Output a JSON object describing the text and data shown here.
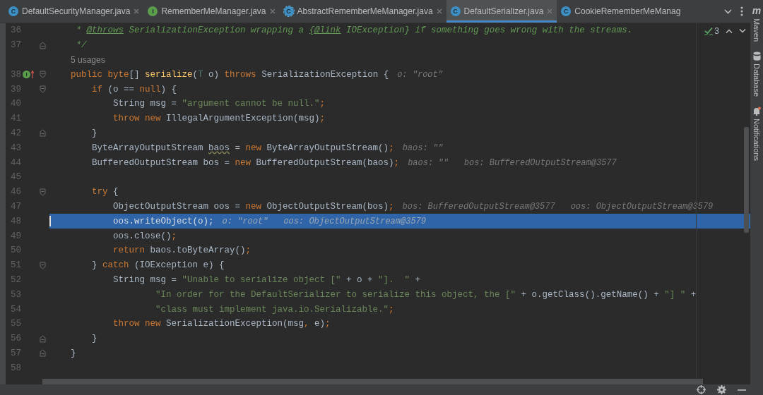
{
  "tabs": [
    {
      "label": "DefaultSecurityManager.java",
      "icon": {
        "kind": "class",
        "letter": "C"
      },
      "selected": false,
      "closable": true
    },
    {
      "label": "RememberMeManager.java",
      "icon": {
        "kind": "interface",
        "letter": "I"
      },
      "selected": false,
      "closable": true
    },
    {
      "label": "AbstractRememberMeManager.java",
      "icon": {
        "kind": "abstract",
        "letter": "C"
      },
      "selected": false,
      "closable": true
    },
    {
      "label": "DefaultSerializer.java",
      "icon": {
        "kind": "class",
        "letter": "C"
      },
      "selected": true,
      "closable": true
    },
    {
      "label": "CookieRememberMeManag",
      "icon": {
        "kind": "class",
        "letter": "C"
      },
      "selected": false,
      "closable": false
    }
  ],
  "inspections": {
    "count": "3"
  },
  "editor": {
    "lines": [
      {
        "kind": "code",
        "number": "36",
        "current": false,
        "tokens": [
          {
            "kind": "doc",
            "text": "     * "
          },
          {
            "kind": "doctag",
            "text": "@throws"
          },
          {
            "kind": "doc",
            "text": " SerializationException wrapping a "
          },
          {
            "kind": "doctag",
            "text": "{@link"
          },
          {
            "kind": "doc",
            "text": " IOException} if something goes wrong with the streams."
          }
        ]
      },
      {
        "kind": "code",
        "number": "37",
        "current": false,
        "fold": {
          "kind": "end"
        },
        "tokens": [
          {
            "kind": "doc",
            "text": "     */"
          }
        ]
      },
      {
        "kind": "usages",
        "text": "5 usages"
      },
      {
        "kind": "code",
        "number": "38",
        "current": false,
        "fold": {
          "kind": "start"
        },
        "marker": {
          "kind": "implements",
          "letter": "I"
        },
        "tokens": [
          {
            "kind": "kw",
            "text": "    public byte"
          },
          {
            "kind": "plain",
            "text": "[] "
          },
          {
            "kind": "fn",
            "text": "serialize"
          },
          {
            "kind": "plain",
            "text": "("
          },
          {
            "kind": "tparam",
            "text": "T"
          },
          {
            "kind": "plain",
            "text": " o) "
          },
          {
            "kind": "kw",
            "text": "throws"
          },
          {
            "kind": "plain",
            "text": " SerializationException {"
          }
        ],
        "hints": [
          "o: \"root\""
        ]
      },
      {
        "kind": "code",
        "number": "39",
        "current": false,
        "fold": {
          "kind": "start"
        },
        "tokens": [
          {
            "kind": "kw",
            "text": "        if"
          },
          {
            "kind": "plain",
            "text": " (o == "
          },
          {
            "kind": "kw",
            "text": "null"
          },
          {
            "kind": "plain",
            "text": ") {"
          }
        ]
      },
      {
        "kind": "code",
        "number": "40",
        "current": false,
        "tokens": [
          {
            "kind": "plain",
            "text": "            String msg = "
          },
          {
            "kind": "str",
            "text": "\"argument cannot be null.\""
          },
          {
            "kind": "punct",
            "text": ";"
          }
        ]
      },
      {
        "kind": "code",
        "number": "41",
        "current": false,
        "tokens": [
          {
            "kind": "kw",
            "text": "            throw new "
          },
          {
            "kind": "plain",
            "text": "IllegalArgumentException(msg)"
          },
          {
            "kind": "punct",
            "text": ";"
          }
        ]
      },
      {
        "kind": "code",
        "number": "42",
        "current": false,
        "fold": {
          "kind": "end"
        },
        "tokens": [
          {
            "kind": "plain",
            "text": "        }"
          }
        ]
      },
      {
        "kind": "code",
        "number": "43",
        "current": false,
        "tokens": [
          {
            "kind": "plain",
            "text": "        ByteArrayOutputStream "
          },
          {
            "kind": "warn",
            "text": "baos"
          },
          {
            "kind": "plain",
            "text": " = "
          },
          {
            "kind": "kw",
            "text": "new"
          },
          {
            "kind": "plain",
            "text": " ByteArrayOutputStream()"
          },
          {
            "kind": "punct",
            "text": ";"
          }
        ],
        "hints": [
          "baos: \"\""
        ]
      },
      {
        "kind": "code",
        "number": "44",
        "current": false,
        "tokens": [
          {
            "kind": "plain",
            "text": "        BufferedOutputStream bos = "
          },
          {
            "kind": "kw",
            "text": "new"
          },
          {
            "kind": "plain",
            "text": " BufferedOutputStream(baos)"
          },
          {
            "kind": "punct",
            "text": ";"
          }
        ],
        "hints": [
          "baos: \"\"",
          "bos: BufferedOutputStream@3577"
        ]
      },
      {
        "kind": "code",
        "number": "45",
        "current": false
      },
      {
        "kind": "code",
        "number": "46",
        "current": false,
        "fold": {
          "kind": "start"
        },
        "tokens": [
          {
            "kind": "kw",
            "text": "        try"
          },
          {
            "kind": "plain",
            "text": " {"
          }
        ]
      },
      {
        "kind": "code",
        "number": "47",
        "current": false,
        "tokens": [
          {
            "kind": "plain",
            "text": "            ObjectOutputStream oos = "
          },
          {
            "kind": "kw",
            "text": "new"
          },
          {
            "kind": "plain",
            "text": " ObjectOutputStream(bos)"
          },
          {
            "kind": "punct",
            "text": ";"
          }
        ],
        "hints": [
          "bos: BufferedOutputStream@3577",
          "oos: ObjectOutputStream@3579"
        ]
      },
      {
        "kind": "code",
        "number": "48",
        "current": true,
        "tokens": [
          {
            "kind": "plain",
            "text": "            oos.writeObject(o)"
          },
          {
            "kind": "punct",
            "text": ";"
          }
        ],
        "hints": [
          "o: \"root\"",
          "oos: ObjectOutputStream@3579"
        ]
      },
      {
        "kind": "code",
        "number": "49",
        "current": false,
        "tokens": [
          {
            "kind": "plain",
            "text": "            oos.close()"
          },
          {
            "kind": "punct",
            "text": ";"
          }
        ]
      },
      {
        "kind": "code",
        "number": "50",
        "current": false,
        "tokens": [
          {
            "kind": "kw",
            "text": "            return"
          },
          {
            "kind": "plain",
            "text": " baos.toByteArray()"
          },
          {
            "kind": "punct",
            "text": ";"
          }
        ]
      },
      {
        "kind": "code",
        "number": "51",
        "current": false,
        "fold": {
          "kind": "start"
        },
        "tokens": [
          {
            "kind": "plain",
            "text": "        } "
          },
          {
            "kind": "kw",
            "text": "catch"
          },
          {
            "kind": "plain",
            "text": " (IOException e) {"
          }
        ]
      },
      {
        "kind": "code",
        "number": "52",
        "current": false,
        "tokens": [
          {
            "kind": "plain",
            "text": "            String msg = "
          },
          {
            "kind": "str",
            "text": "\"Unable to serialize object [\""
          },
          {
            "kind": "plain",
            "text": " + o + "
          },
          {
            "kind": "str",
            "text": "\"].  \""
          },
          {
            "kind": "plain",
            "text": " +"
          }
        ]
      },
      {
        "kind": "code",
        "number": "53",
        "current": false,
        "tokens": [
          {
            "kind": "str",
            "text": "                    \"In order for the DefaultSerializer to serialize this object, the [\""
          },
          {
            "kind": "plain",
            "text": " + o.getClass().getName() + "
          },
          {
            "kind": "str",
            "text": "\"] \""
          },
          {
            "kind": "plain",
            "text": " +"
          }
        ]
      },
      {
        "kind": "code",
        "number": "54",
        "current": false,
        "tokens": [
          {
            "kind": "str",
            "text": "                    \"class must implement java.io.Serializable.\""
          },
          {
            "kind": "punct",
            "text": ";"
          }
        ]
      },
      {
        "kind": "code",
        "number": "55",
        "current": false,
        "tokens": [
          {
            "kind": "kw",
            "text": "            throw new "
          },
          {
            "kind": "plain",
            "text": "SerializationException(msg"
          },
          {
            "kind": "punct",
            "text": ","
          },
          {
            "kind": "plain",
            "text": " e)"
          },
          {
            "kind": "punct",
            "text": ";"
          }
        ]
      },
      {
        "kind": "code",
        "number": "56",
        "current": false,
        "fold": {
          "kind": "end"
        },
        "tokens": [
          {
            "kind": "plain",
            "text": "        }"
          }
        ]
      },
      {
        "kind": "code",
        "number": "57",
        "current": false,
        "fold": {
          "kind": "end"
        },
        "tokens": [
          {
            "kind": "plain",
            "text": "    }"
          }
        ]
      },
      {
        "kind": "code",
        "number": "58",
        "current": false
      }
    ]
  },
  "right_toolbar": [
    {
      "label": "Maven",
      "icon": {
        "kind": "maven",
        "glyph": "m"
      }
    },
    {
      "label": "Database",
      "icon": {
        "kind": "database"
      }
    },
    {
      "label": "Notifications",
      "icon": {
        "kind": "bell"
      }
    }
  ]
}
